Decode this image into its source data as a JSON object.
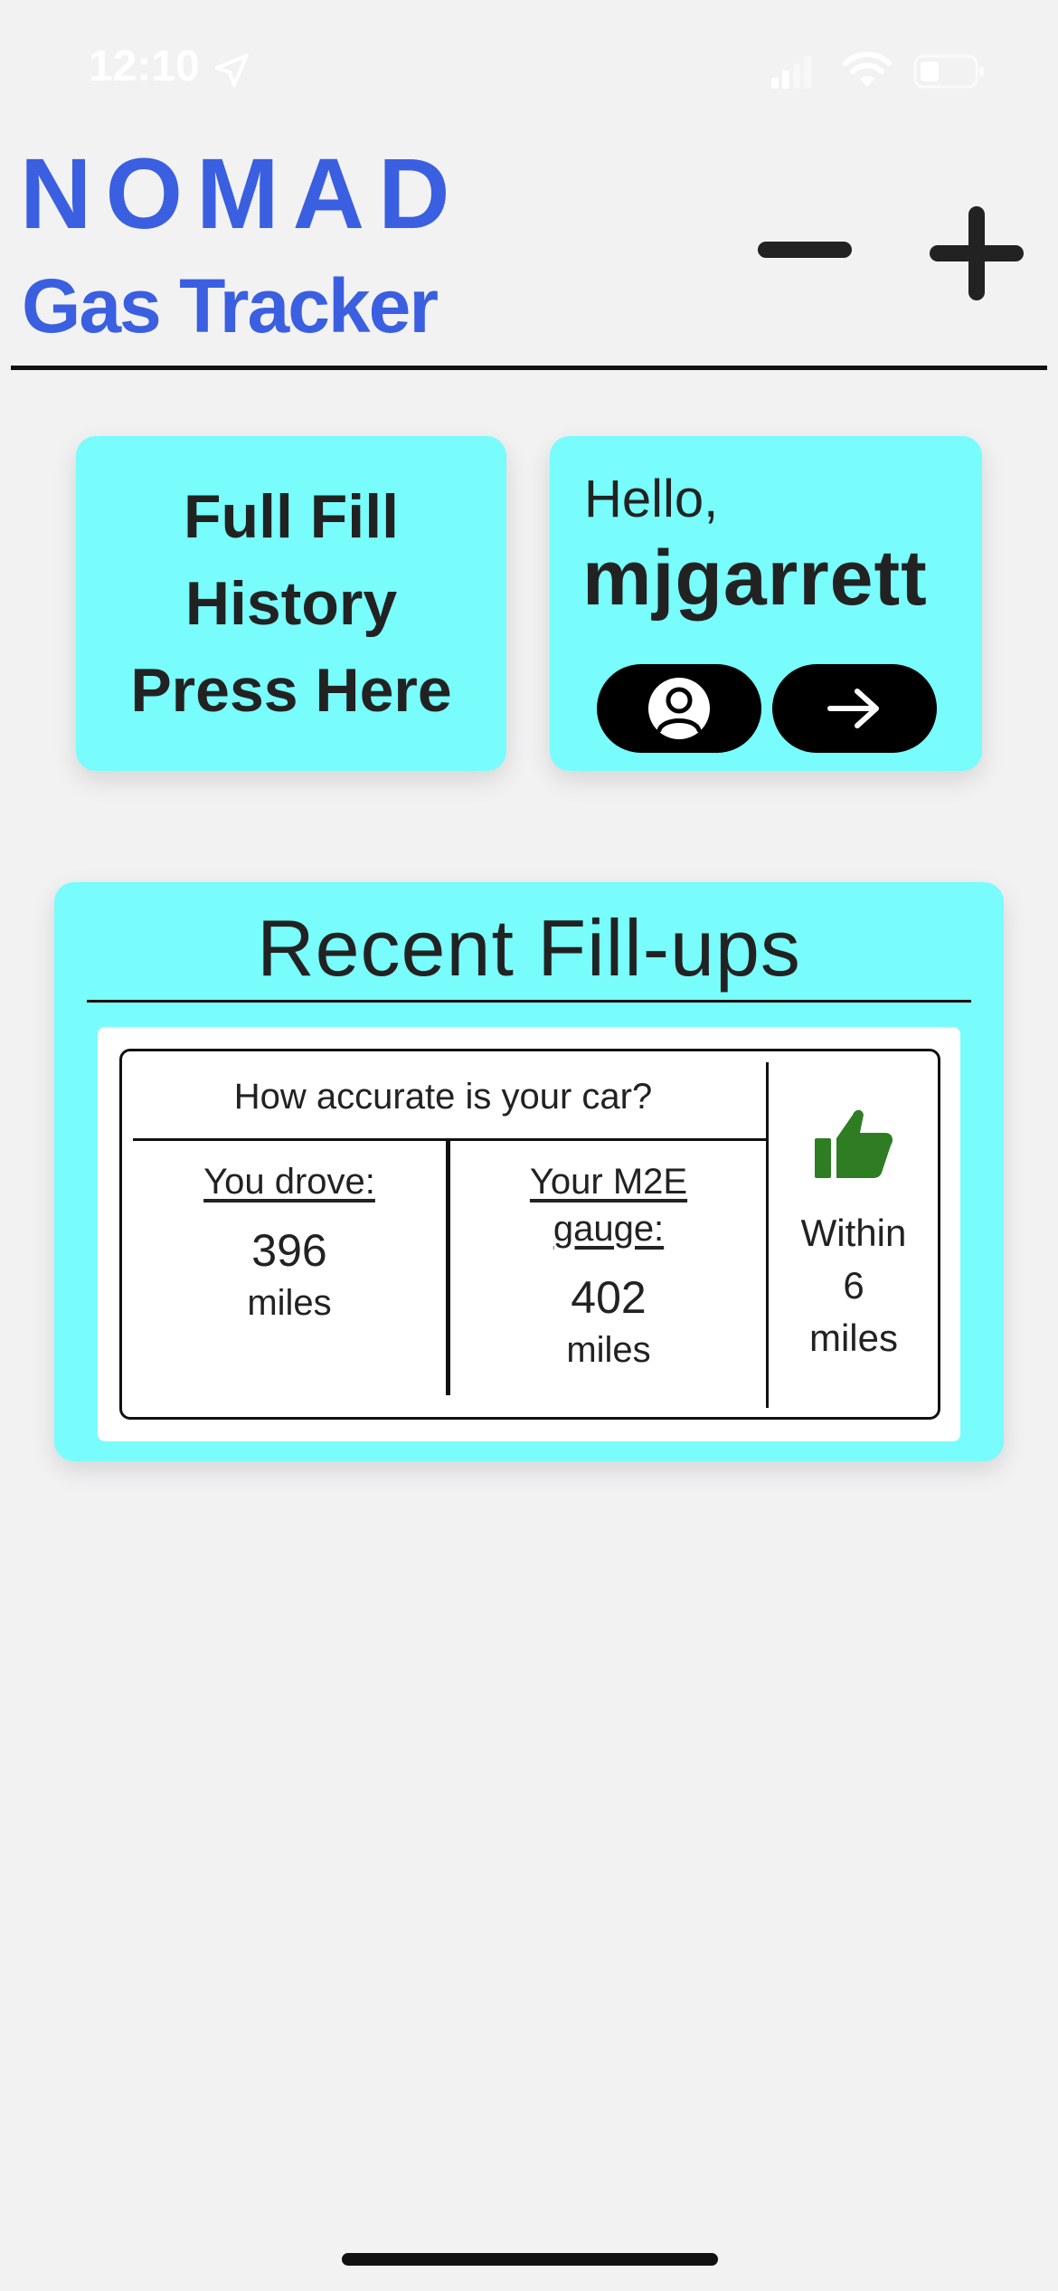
{
  "status_bar": {
    "time": "12:10",
    "icons": [
      "location-arrow-icon",
      "cellular-signal-icon",
      "wifi-icon",
      "battery-icon"
    ]
  },
  "header": {
    "brand": "NOMAD",
    "subtitle": "Gas Tracker",
    "minus_icon": "minus-icon",
    "plus_icon": "plus-icon"
  },
  "history_card": {
    "line1": "Full Fill",
    "line2": "History",
    "line3": "Press Here"
  },
  "greeting_card": {
    "hello": "Hello,",
    "username": "mjgarrett",
    "profile_icon": "user-profile-icon",
    "next_icon": "arrow-right-icon"
  },
  "recent_fillups": {
    "title": "Recent Fill-ups",
    "question": "How accurate is your car?",
    "drove_label": "You drove:",
    "drove_value": "396",
    "drove_unit": "miles",
    "gauge_label_line1": "Your M2E",
    "gauge_label_line2": "gauge:",
    "gauge_value": "402",
    "gauge_unit": "miles",
    "verdict_icon": "thumbs-up-icon",
    "verdict_line1": "Within",
    "verdict_line2": "6",
    "verdict_line3": "miles"
  },
  "colors": {
    "background": "#f2f2f3",
    "brand_blue": "#3a5fe0",
    "card_cyan": "#78fcfc",
    "thumb_green": "#2e7d22",
    "button_black": "#000000"
  }
}
